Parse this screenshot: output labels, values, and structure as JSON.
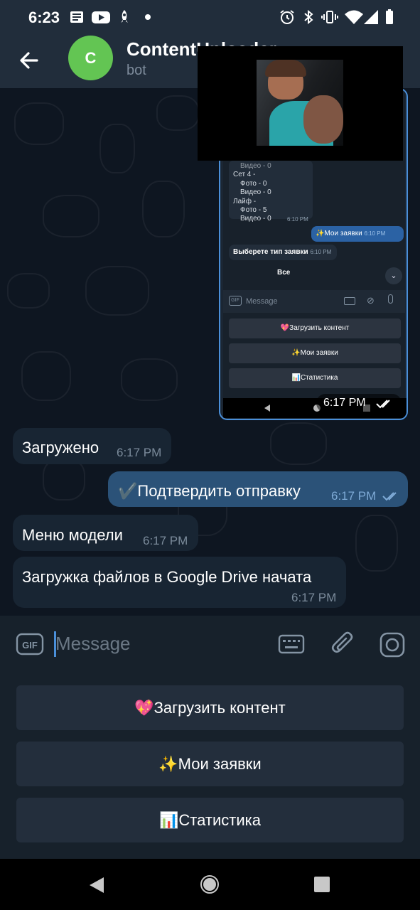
{
  "status_bar": {
    "time": "6:23",
    "left_icons": [
      "news-icon",
      "youtube-icon",
      "rocket-icon",
      "dot-icon"
    ],
    "right_icons": [
      "alarm-icon",
      "bluetooth-icon",
      "vibrate-icon",
      "wifi-icon",
      "signal-icon",
      "battery-icon"
    ]
  },
  "header": {
    "avatar_letter": "C",
    "avatar_color": "#63c553",
    "title": "ContentUploader",
    "subtitle": "bot"
  },
  "embedded_screenshot": {
    "list_lines": [
      "Видео - 0",
      "Сет 4 -",
      "Фото - 0",
      "Видео - 0",
      "Лайф -",
      "Фото - 5",
      "Видео - 0"
    ],
    "list_time": "6:10 PM",
    "out_message": "✨Мои заявки",
    "out_time": "6:10 PM",
    "in_message": "Выберете тип заявки",
    "in_time": "6:10 PM",
    "select_value": "Все",
    "input_placeholder": "Message",
    "keyboard_buttons": [
      "💖Загрузить контент",
      "✨Мои заявки",
      "📊Статистика"
    ],
    "bubble_time": "6:17 PM"
  },
  "messages": [
    {
      "direction": "in",
      "text": "Загружено",
      "time": "6:17 PM"
    },
    {
      "direction": "out",
      "text": "✔️Подтвердить отправку",
      "time": "6:17 PM"
    },
    {
      "direction": "in",
      "text": "Меню модели",
      "time": "6:17 PM"
    },
    {
      "direction": "in",
      "text": "Загружка файлов в Google Drive начата",
      "time": "6:17 PM"
    }
  ],
  "input": {
    "placeholder": "Message",
    "icons": [
      "gif-icon",
      "keyboard-icon",
      "attach-icon",
      "camera-icon"
    ]
  },
  "reply_keyboard": {
    "buttons": [
      "💖Загрузить контент",
      "✨Мои заявки",
      "📊Статистика"
    ]
  },
  "nav_bar": {
    "buttons": [
      "back-nav-icon",
      "home-nav-icon",
      "recents-nav-icon"
    ]
  },
  "colors": {
    "header_bg": "#212d3b",
    "chat_bg": "#0e1621",
    "incoming_bubble": "#182533",
    "outgoing_bubble": "#2b5278",
    "accent": "#4a8fd9"
  }
}
